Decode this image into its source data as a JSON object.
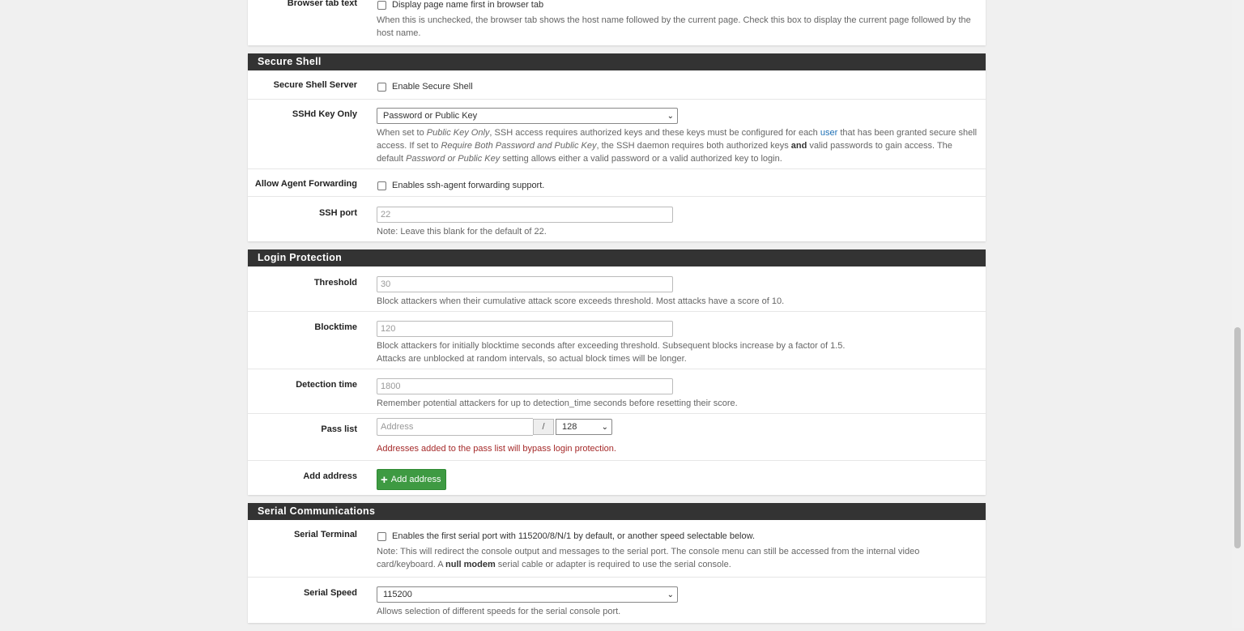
{
  "browser_tab": {
    "label": "Browser tab text",
    "checkbox_label": "Display page name first in browser tab",
    "help": "When this is unchecked, the browser tab shows the host name followed by the current page. Check this box to display the current page followed by the host name."
  },
  "secure_shell": {
    "heading": "Secure Shell",
    "server_label": "Secure Shell Server",
    "server_checkbox": "Enable Secure Shell",
    "key_only_label": "SSHd Key Only",
    "key_only_selected": "Password or Public Key",
    "key_help": {
      "p1": "When set to ",
      "e1": "Public Key Only",
      "p2": ", SSH access requires authorized keys and these keys must be configured for each ",
      "link": "user",
      "p3": " that has been granted secure shell access. If set to ",
      "e2": "Require Both Password and Public Key",
      "p4": ", the SSH daemon requires both authorized keys ",
      "b1": "and",
      "p5": " valid passwords to gain access. The default ",
      "e3": "Password or Public Key",
      "p6": " setting allows either a valid password or a valid authorized key to login."
    },
    "agent_label": "Allow Agent Forwarding",
    "agent_checkbox": "Enables ssh-agent forwarding support.",
    "port_label": "SSH port",
    "port_placeholder": "22",
    "port_help": "Note: Leave this blank for the default of 22."
  },
  "login_protection": {
    "heading": "Login Protection",
    "threshold_label": "Threshold",
    "threshold_placeholder": "30",
    "threshold_help": "Block attackers when their cumulative attack score exceeds threshold. Most attacks have a score of 10.",
    "blocktime_label": "Blocktime",
    "blocktime_placeholder": "120",
    "blocktime_help1": "Block attackers for initially blocktime seconds after exceeding threshold. Subsequent blocks increase by a factor of 1.5.",
    "blocktime_help2": "Attacks are unblocked at random intervals, so actual block times will be longer.",
    "detection_label": "Detection time",
    "detection_placeholder": "1800",
    "detection_help": "Remember potential attackers for up to detection_time seconds before resetting their score.",
    "passlist_label": "Pass list",
    "address_placeholder": "Address",
    "slash": "/",
    "mask_selected": "128",
    "passlist_help": "Addresses added to the pass list will bypass login protection.",
    "add_label": "Add address",
    "add_button": "Add address"
  },
  "serial": {
    "heading": "Serial Communications",
    "terminal_label": "Serial Terminal",
    "terminal_checkbox": "Enables the first serial port with 115200/8/N/1 by default, or another speed selectable below.",
    "terminal_help": {
      "p1": "Note: This will redirect the console output and messages to the serial port. The console menu can still be accessed from the internal video card/keyboard. A ",
      "b1": "null modem",
      "p2": " serial cable or adapter is required to use the serial console."
    },
    "speed_label": "Serial Speed",
    "speed_selected": "115200",
    "speed_help": "Allows selection of different speeds for the serial console port."
  },
  "colors": {
    "heading_bg": "#333333",
    "button_green": "#3e9a42",
    "warning_red": "#a52a2a",
    "link_blue": "#1c6fb5"
  }
}
